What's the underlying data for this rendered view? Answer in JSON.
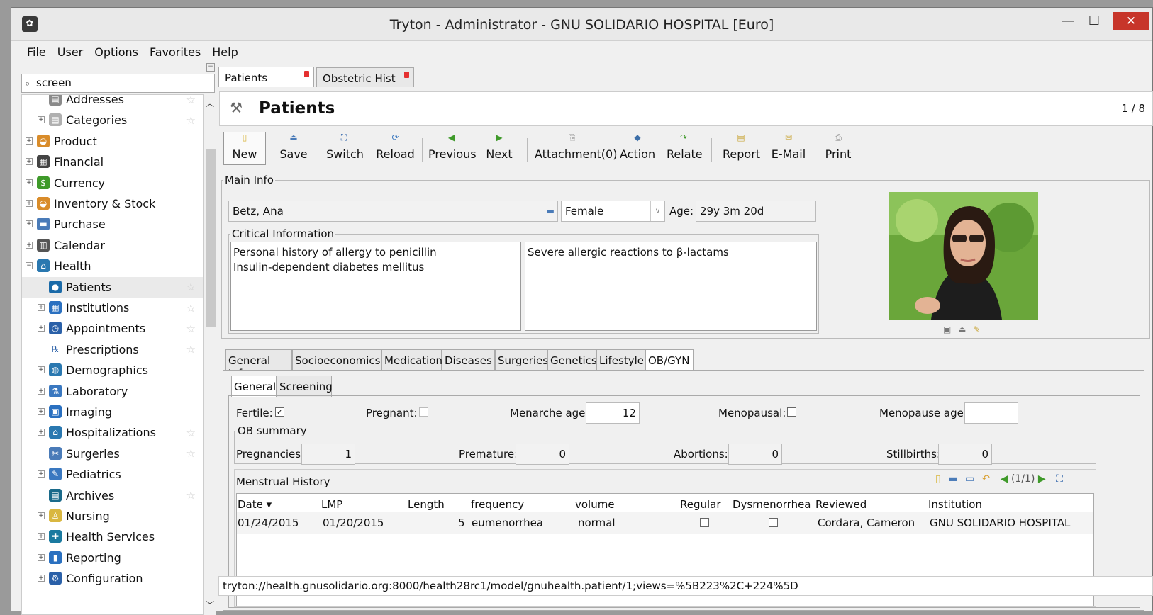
{
  "window": {
    "title": "Tryton - Administrator - GNU SOLIDARIO HOSPITAL [Euro]"
  },
  "menu": [
    "File",
    "User",
    "Options",
    "Favorites",
    "Help"
  ],
  "search": {
    "value": "screen"
  },
  "tree": [
    {
      "label": "Addresses",
      "indent": 2,
      "icon": "addresses-icon",
      "star": true,
      "expand": false
    },
    {
      "label": "Categories",
      "indent": 2,
      "icon": "categories-icon",
      "star": true,
      "expand": true
    },
    {
      "label": "Product",
      "indent": 1,
      "icon": "product-icon",
      "star": false,
      "expand": true
    },
    {
      "label": "Financial",
      "indent": 1,
      "icon": "financial-icon",
      "star": false,
      "expand": true
    },
    {
      "label": "Currency",
      "indent": 1,
      "icon": "currency-icon",
      "star": false,
      "expand": true
    },
    {
      "label": "Inventory & Stock",
      "indent": 1,
      "icon": "inventory-icon",
      "star": false,
      "expand": true
    },
    {
      "label": "Purchase",
      "indent": 1,
      "icon": "purchase-icon",
      "star": false,
      "expand": true
    },
    {
      "label": "Calendar",
      "indent": 1,
      "icon": "calendar-icon",
      "star": false,
      "expand": true
    },
    {
      "label": "Health",
      "indent": 1,
      "icon": "health-icon",
      "star": false,
      "expand": true,
      "open": true
    },
    {
      "label": "Patients",
      "indent": 2,
      "icon": "patients-icon",
      "star": true,
      "expand": false,
      "selected": true
    },
    {
      "label": "Institutions",
      "indent": 2,
      "icon": "institutions-icon",
      "star": true,
      "expand": true
    },
    {
      "label": "Appointments",
      "indent": 2,
      "icon": "appointments-icon",
      "star": true,
      "expand": true
    },
    {
      "label": "Prescriptions",
      "indent": 2,
      "icon": "prescriptions-icon",
      "star": true,
      "expand": false
    },
    {
      "label": "Demographics",
      "indent": 2,
      "icon": "demographics-icon",
      "star": false,
      "expand": true
    },
    {
      "label": "Laboratory",
      "indent": 2,
      "icon": "laboratory-icon",
      "star": false,
      "expand": true
    },
    {
      "label": "Imaging",
      "indent": 2,
      "icon": "imaging-icon",
      "star": false,
      "expand": true
    },
    {
      "label": "Hospitalizations",
      "indent": 2,
      "icon": "hospitalizations-icon",
      "star": true,
      "expand": true
    },
    {
      "label": "Surgeries",
      "indent": 2,
      "icon": "surgeries-icon",
      "star": true,
      "expand": false
    },
    {
      "label": "Pediatrics",
      "indent": 2,
      "icon": "pediatrics-icon",
      "star": false,
      "expand": true
    },
    {
      "label": "Archives",
      "indent": 2,
      "icon": "archives-icon",
      "star": true,
      "expand": false
    },
    {
      "label": "Nursing",
      "indent": 2,
      "icon": "nursing-icon",
      "star": false,
      "expand": true
    },
    {
      "label": "Health Services",
      "indent": 2,
      "icon": "health-services-icon",
      "star": false,
      "expand": true
    },
    {
      "label": "Reporting",
      "indent": 2,
      "icon": "reporting-icon",
      "star": false,
      "expand": true
    },
    {
      "label": "Configuration",
      "indent": 2,
      "icon": "configuration-icon",
      "star": false,
      "expand": true
    }
  ],
  "tabs": [
    {
      "label": "Patients"
    },
    {
      "label": "Obstetric Hist ..."
    }
  ],
  "form": {
    "title": "Patients",
    "count": "1 / 8"
  },
  "toolbar": {
    "new": "New",
    "save": "Save",
    "switch": "Switch",
    "reload": "Reload",
    "previous": "Previous",
    "next": "Next",
    "attachment": "Attachment(0)",
    "action": "Action",
    "relate": "Relate",
    "report": "Report",
    "email": "E-Mail",
    "print": "Print"
  },
  "main_info": {
    "legend": "Main Info",
    "name": "Betz, Ana",
    "sex": "Female",
    "age_label": "Age:",
    "age": "29y 3m 20d",
    "critical_legend": "Critical Information",
    "critical_left": [
      "Personal history of allergy to penicillin",
      "Insulin-dependent diabetes mellitus"
    ],
    "critical_right": "Severe allergic reactions to β-lactams"
  },
  "section_tabs": [
    "General Info",
    "Socioeconomics",
    "Medication",
    "Diseases",
    "Surgeries",
    "Genetics",
    "Lifestyle",
    "OB/GYN"
  ],
  "obgyn_tabs": [
    "General",
    "Screening"
  ],
  "obgyn": {
    "fertile_label": "Fertile:",
    "fertile": true,
    "pregnant_label": "Pregnant:",
    "pregnant": false,
    "menarche_label": "Menarche age:",
    "menarche": "12",
    "menopausal_label": "Menopausal:",
    "menopausal": false,
    "menopause_label": "Menopause age:",
    "menopause": "",
    "summary_legend": "OB summary",
    "pregnancies_label": "Pregnancies:",
    "pregnancies": "1",
    "premature_label": "Premature:",
    "premature": "0",
    "abortions_label": "Abortions:",
    "abortions": "0",
    "stillbirths_label": "Stillbirths:",
    "stillbirths": "0"
  },
  "menstrual": {
    "title": "Menstrual History",
    "pager": "(1/1)",
    "columns": [
      "Date ▾",
      "LMP",
      "Length",
      "frequency",
      "volume",
      "Regular",
      "Dysmenorrhea",
      "Reviewed",
      "Institution"
    ],
    "rows": [
      {
        "date": "01/24/2015",
        "lmp": "01/20/2015",
        "length": "5",
        "frequency": "eumenorrhea",
        "volume": "normal",
        "regular": false,
        "dysmenorrhea": false,
        "reviewed": "Cordara, Cameron",
        "institution": "GNU SOLIDARIO HOSPITAL"
      }
    ]
  },
  "status": {
    "url": "tryton://health.gnusolidario.org:8000/health28rc1/model/gnuhealth.patient/1;views=%5B223%2C+224%5D"
  },
  "colors": {
    "close": "#c7352a",
    "pin": "#e53030"
  }
}
